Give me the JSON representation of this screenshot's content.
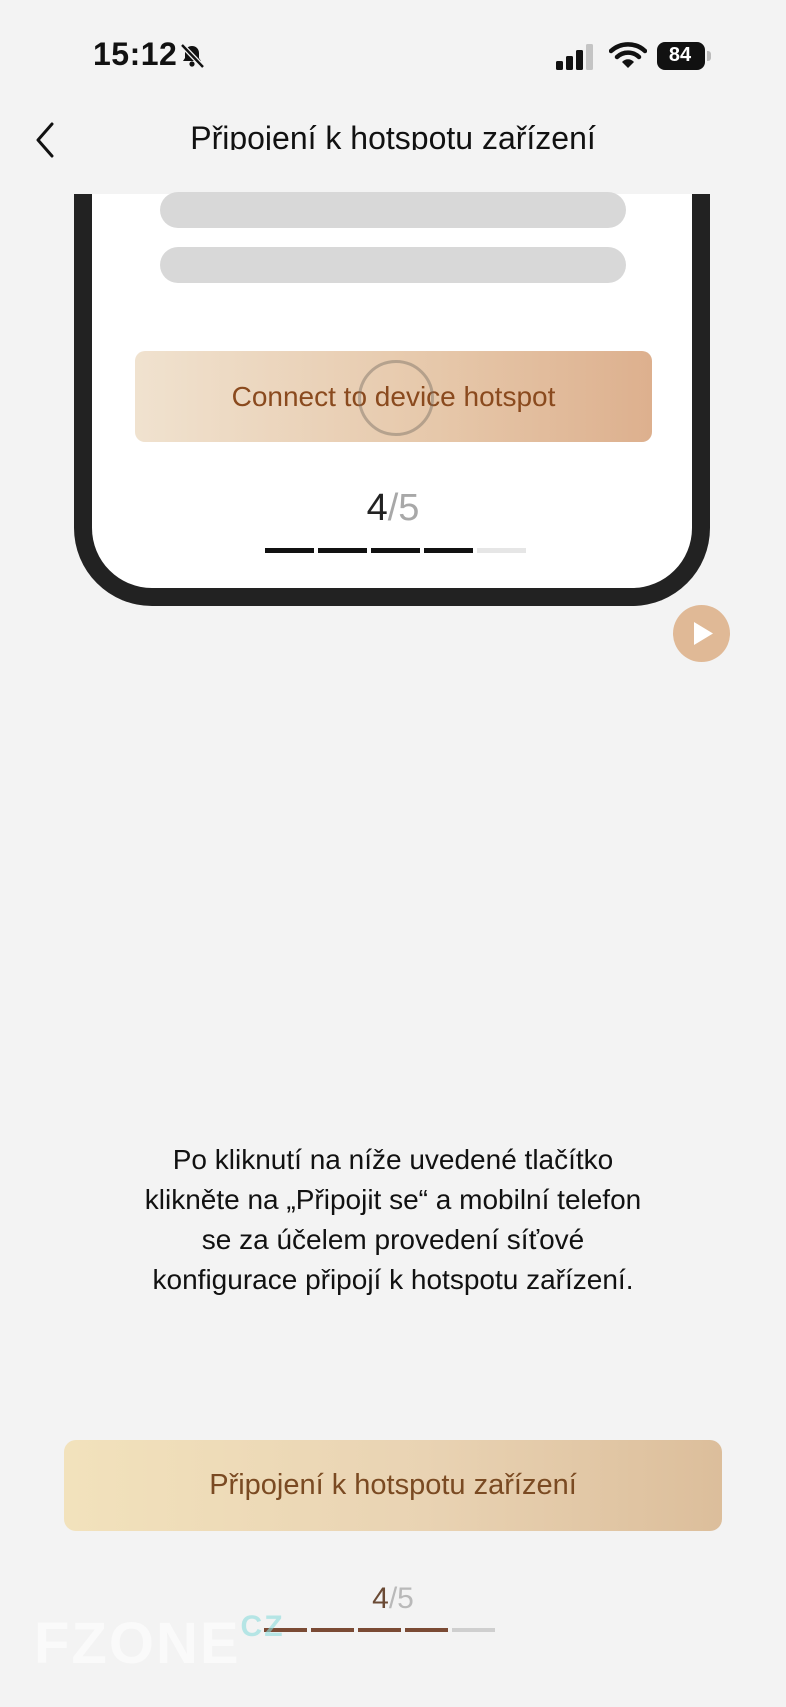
{
  "status_bar": {
    "time": "15:12",
    "battery": "84"
  },
  "nav": {
    "title": "Připojení k hotspotu zařízení"
  },
  "illustration": {
    "button_label": "Connect to device hotspot",
    "step_current": "4",
    "step_total": "/5",
    "progress": {
      "current": 4,
      "total": 5
    }
  },
  "instruction": {
    "text": "Po kliknutí na níže uvedené tlačítko klikněte na „Připojit se“ a mobilní telefon se za účelem provedení síťové konfigurace připojí k hotspotu zařízení."
  },
  "main_button": {
    "label": "Připojení k hotspotu zařízení"
  },
  "pager": {
    "current": "4",
    "total": "/5",
    "progress": {
      "current": 4,
      "total": 5
    }
  },
  "watermark": {
    "text": "FZONE",
    "suffix": "CZ"
  },
  "colors": {
    "background": "#f3f3f3",
    "accent_text": "#8a4a1e",
    "play_button": "#e0b996"
  },
  "icons": {
    "back": "chevron-left-icon",
    "mute": "bell-slash-icon",
    "signal": "cellular-signal-icon",
    "wifi": "wifi-icon",
    "battery": "battery-icon",
    "play": "play-icon"
  }
}
